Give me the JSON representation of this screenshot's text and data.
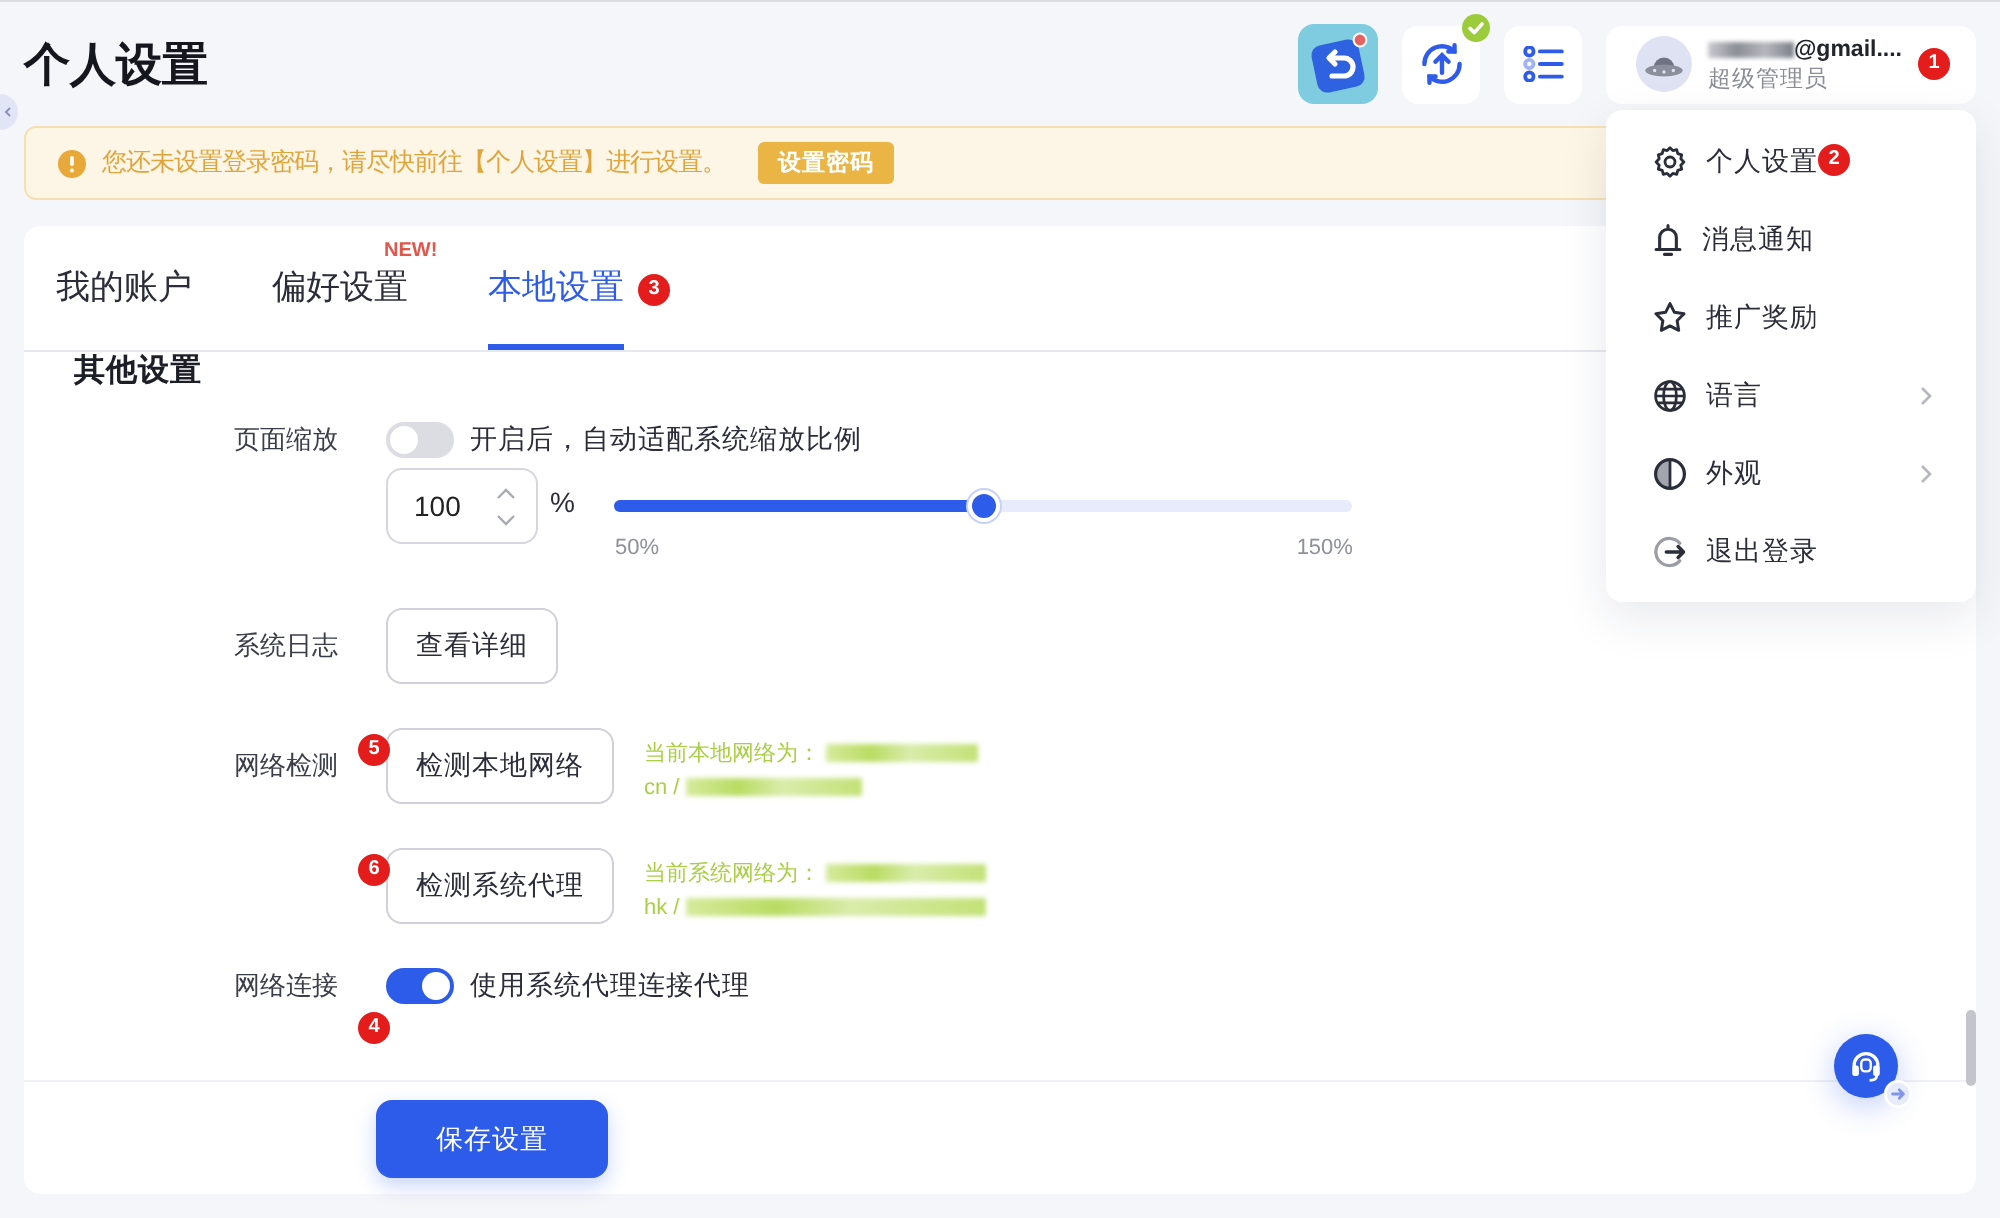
{
  "header": {
    "title": "个人设置"
  },
  "user": {
    "email": "@gmail....",
    "role": "超级管理员",
    "marker": "1"
  },
  "alert": {
    "message": "您还未设置登录密码，请尽快前往【个人设置】进行设置。",
    "button": "设置密码"
  },
  "tabs": [
    {
      "label": "我的账户",
      "selected": false
    },
    {
      "label": "偏好设置",
      "selected": false,
      "tag": "NEW!"
    },
    {
      "label": "本地设置",
      "selected": true,
      "marker": "3"
    }
  ],
  "section": {
    "title": "其他设置",
    "rows": [
      {
        "kind": "zoom",
        "label": "页面缩放",
        "toggle": {
          "on": false,
          "text": "开启后，自动适配系统缩放比例"
        },
        "input": {
          "value": "100",
          "unit": "%"
        },
        "slider": {
          "level": 0.5,
          "min_label": "50%",
          "max_label": "150%"
        }
      },
      {
        "kind": "action",
        "label": "系统日志",
        "button": "查看详细"
      },
      {
        "kind": "check",
        "label": "网络检测",
        "button": "检测本地网络",
        "marker": "5",
        "result": [
          "当前本地网络为：",
          "cn /"
        ]
      },
      {
        "kind": "check",
        "button": "检测系统代理",
        "marker": "6",
        "result": [
          "当前系统网络为：",
          "hk /"
        ]
      },
      {
        "kind": "switch",
        "label": "网络连接",
        "on": true,
        "text": "使用系统代理连接代理",
        "marker": "4"
      }
    ]
  },
  "save_button": "保存设置",
  "menu": {
    "items": [
      {
        "label": "个人设置",
        "submenu": false,
        "marker": "2"
      },
      {
        "label": "消息通知",
        "submenu": false
      },
      {
        "label": "推广奖励",
        "submenu": false
      },
      {
        "label": "语言",
        "submenu": true
      },
      {
        "label": "外观",
        "submenu": true
      },
      {
        "label": "退出登录",
        "submenu": false
      }
    ]
  }
}
